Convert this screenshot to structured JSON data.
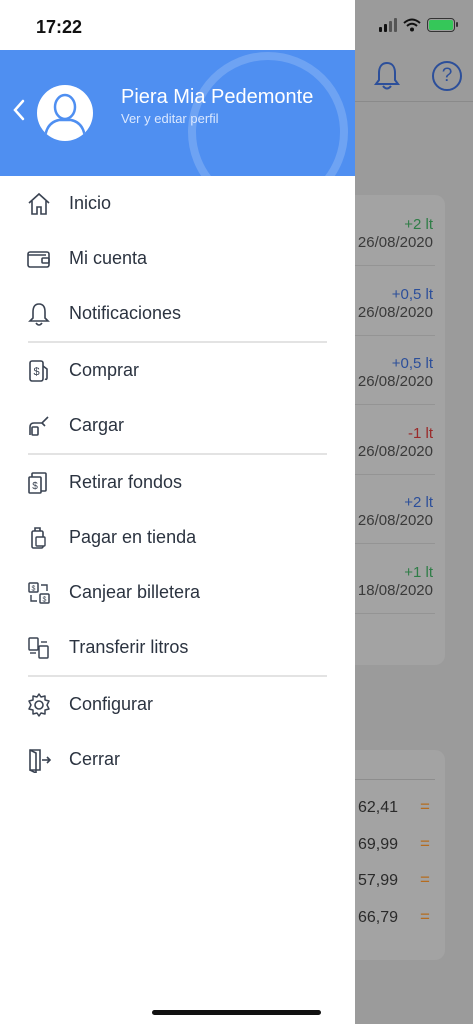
{
  "status_bar": {
    "time": "17:22"
  },
  "profile": {
    "name": "Piera Mia Pedemonte",
    "subtitle": "Ver y editar perfil"
  },
  "menu": {
    "groups": [
      [
        {
          "label": "Inicio",
          "icon": "home-icon"
        },
        {
          "label": "Mi cuenta",
          "icon": "wallet-icon"
        },
        {
          "label": "Notificaciones",
          "icon": "bell-icon"
        }
      ],
      [
        {
          "label": "Comprar",
          "icon": "fuel-dollar-icon"
        },
        {
          "label": "Cargar",
          "icon": "fuel-nozzle-icon"
        }
      ],
      [
        {
          "label": "Retirar fondos",
          "icon": "withdraw-cash-icon"
        },
        {
          "label": "Pagar en tienda",
          "icon": "pay-store-icon"
        },
        {
          "label": "Canjear billetera",
          "icon": "exchange-wallet-icon"
        },
        {
          "label": "Transferir litros",
          "icon": "transfer-liters-icon"
        }
      ],
      [
        {
          "label": "Configurar",
          "icon": "gear-icon"
        },
        {
          "label": "Cerrar",
          "icon": "logout-icon"
        }
      ]
    ]
  },
  "background": {
    "transactions": [
      {
        "amount": "+2 lt",
        "date": "26/08/2020",
        "color": "green"
      },
      {
        "amount": "+0,5 lt",
        "date": "26/08/2020",
        "color": "blue"
      },
      {
        "amount": "+0,5 lt",
        "date": "26/08/2020",
        "color": "blue"
      },
      {
        "amount": "-1 lt",
        "date": "26/08/2020",
        "color": "red"
      },
      {
        "amount": "+2 lt",
        "date": "26/08/2020",
        "color": "blue"
      },
      {
        "amount": "+1 lt",
        "date": "18/08/2020",
        "color": "green"
      }
    ],
    "prices": [
      {
        "value": "62,41",
        "trend": "="
      },
      {
        "value": "69,99",
        "trend": "="
      },
      {
        "value": "57,99",
        "trend": "="
      },
      {
        "value": "66,79",
        "trend": "="
      }
    ],
    "help_glyph": "?"
  },
  "colors": {
    "header_blue": "#4f8ff1",
    "text_dark": "#2b3340",
    "positive_green": "#2f7d47",
    "positive_blue": "#2c4f9a",
    "negative_red": "#9a2a2a",
    "trend_orange": "#b56c1f"
  }
}
